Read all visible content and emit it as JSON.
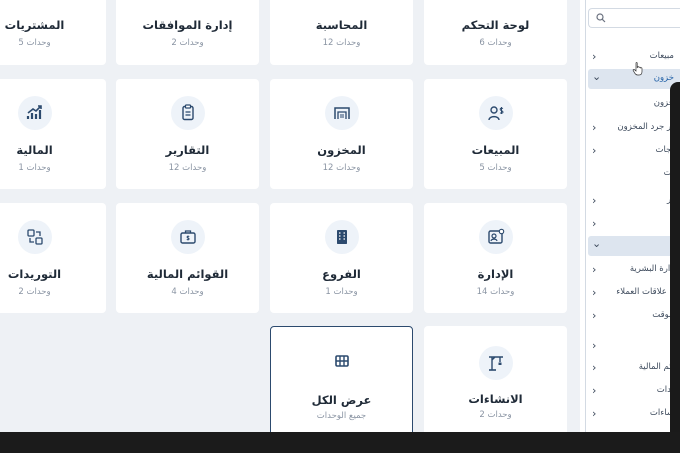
{
  "cards": [
    {
      "title": "المشتريات",
      "units": "5 وحدات"
    },
    {
      "title": "إدارة الموافقات",
      "units": "2 وحدات"
    },
    {
      "title": "المحاسبة",
      "units": "12 وحدات"
    },
    {
      "title": "لوحة التحكم",
      "units": "6 وحدات"
    },
    {
      "title": "المالية",
      "units": "1 وحدات",
      "icon": "chart-up-icon"
    },
    {
      "title": "التقارير",
      "units": "12 وحدات",
      "icon": "clipboard-icon"
    },
    {
      "title": "المخزون",
      "units": "12 وحدات",
      "icon": "warehouse-icon"
    },
    {
      "title": "المبيعات",
      "units": "5 وحدات",
      "icon": "users-dollar-icon"
    },
    {
      "title": "التوريدات",
      "units": "2 وحدات",
      "icon": "transfer-icon"
    },
    {
      "title": "القوائم المالية",
      "units": "4 وحدات",
      "icon": "briefcase-dollar-icon"
    },
    {
      "title": "الفروع",
      "units": "1 وحدات",
      "icon": "building-icon"
    },
    {
      "title": "الإدارة",
      "units": "14 وحدات",
      "icon": "id-card-icon"
    },
    {
      "title": "عرض الكل",
      "units": "جميع الوحدات",
      "icon": "grid-icon"
    },
    {
      "title": "الانشاءات",
      "units": "2 وحدات",
      "icon": "crane-icon"
    }
  ],
  "sidebar": {
    "search_placeholder": "",
    "items": [
      {
        "label": "مبيعات",
        "chevron": "›"
      },
      {
        "label": "خزون",
        "chevron": "⌄"
      },
      {
        "label": "خزون",
        "chevron": ""
      },
      {
        "label": "ير جرد المخزون",
        "chevron": "›"
      },
      {
        "label": "تجات",
        "chevron": "›"
      },
      {
        "label": "ات",
        "chevron": ""
      },
      {
        "label": "ير",
        "chevron": "›"
      },
      {
        "label": "",
        "chevron": "›"
      },
      {
        "label": "",
        "chevron": "⌄"
      },
      {
        "label": "دارة البشرية",
        "chevron": "›"
      },
      {
        "label": "ة علاقات العملاء",
        "chevron": "›"
      },
      {
        "label": "الوقت",
        "chevron": "›"
      },
      {
        "label": "ة",
        "chevron": "›"
      },
      {
        "label": "ائم المالية",
        "chevron": "›"
      },
      {
        "label": "يدات",
        "chevron": "›"
      },
      {
        "label": "ساءات",
        "chevron": "›"
      }
    ]
  },
  "colors": {
    "accent": "#2c4a6e",
    "active_bg": "#dde5ef",
    "card_bg": "#ffffff",
    "page_bg": "#eef1f5"
  }
}
